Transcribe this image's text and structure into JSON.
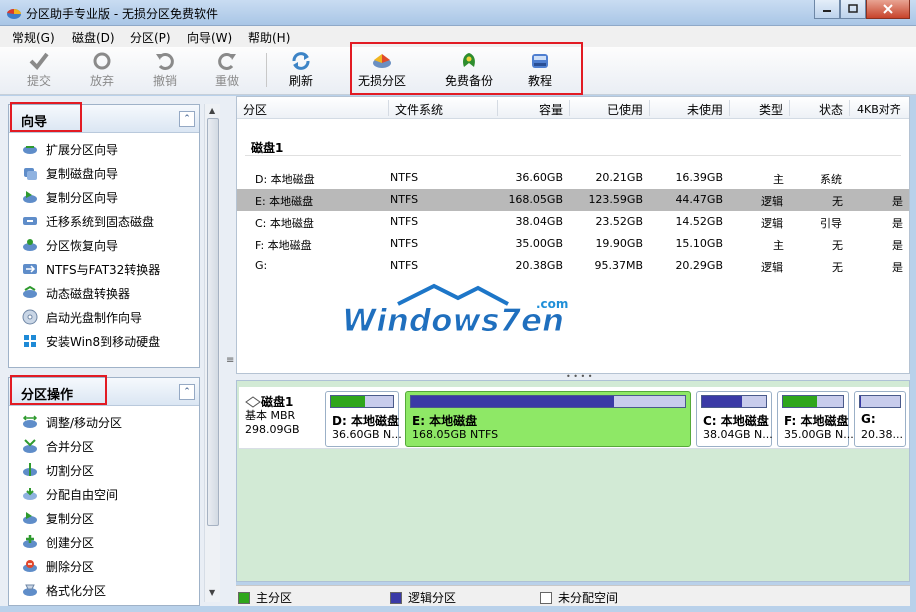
{
  "window": {
    "title": "分区助手专业版 - 无损分区免费软件"
  },
  "menu": [
    "常规(G)",
    "磁盘(D)",
    "分区(P)",
    "向导(W)",
    "帮助(H)"
  ],
  "toolbar": {
    "commit": "提交",
    "discard": "放弃",
    "undo": "撤销",
    "redo": "重做",
    "refresh": "刷新",
    "lossless": "无损分区",
    "backup": "免费备份",
    "tutorial": "教程"
  },
  "wizards": {
    "title": "向导",
    "items": [
      "扩展分区向导",
      "复制磁盘向导",
      "复制分区向导",
      "迁移系统到固态磁盘",
      "分区恢复向导",
      "NTFS与FAT32转换器",
      "动态磁盘转换器",
      "启动光盘制作向导",
      "安装Win8到移动硬盘"
    ]
  },
  "partition_ops": {
    "title": "分区操作",
    "items": [
      "调整/移动分区",
      "合并分区",
      "切割分区",
      "分配自由空间",
      "复制分区",
      "创建分区",
      "删除分区",
      "格式化分区"
    ]
  },
  "table": {
    "headers": [
      "分区",
      "文件系统",
      "容量",
      "已使用",
      "未使用",
      "类型",
      "状态",
      "4KB对齐"
    ],
    "disk_label": "磁盘1",
    "rows": [
      {
        "part": "D: 本地磁盘",
        "fs": "NTFS",
        "cap": "36.60GB",
        "used": "20.21GB",
        "free": "16.39GB",
        "type": "主",
        "status": "系统",
        "align": ""
      },
      {
        "part": "E: 本地磁盘",
        "fs": "NTFS",
        "cap": "168.05GB",
        "used": "123.59GB",
        "free": "44.47GB",
        "type": "逻辑",
        "status": "无",
        "align": "是"
      },
      {
        "part": "C: 本地磁盘",
        "fs": "NTFS",
        "cap": "38.04GB",
        "used": "23.52GB",
        "free": "14.52GB",
        "type": "逻辑",
        "status": "引导",
        "align": "是"
      },
      {
        "part": "F: 本地磁盘",
        "fs": "NTFS",
        "cap": "35.00GB",
        "used": "19.90GB",
        "free": "15.10GB",
        "type": "主",
        "status": "无",
        "align": "是"
      },
      {
        "part": "G:",
        "fs": "NTFS",
        "cap": "20.38GB",
        "used": "95.37MB",
        "free": "20.29GB",
        "type": "逻辑",
        "status": "无",
        "align": "是"
      }
    ]
  },
  "watermark": {
    "main": "Windows7en",
    "com": ".com"
  },
  "diskmap": {
    "disk": {
      "name": "磁盘1",
      "type": "基本 MBR",
      "size": "298.09GB"
    },
    "partitions": [
      {
        "name": "D: 本地磁盘",
        "detail": "36.60GB N...",
        "used": 0.55,
        "kind": "primary"
      },
      {
        "name": "E: 本地磁盘",
        "detail": "168.05GB NTFS",
        "used": 0.74,
        "kind": "logical"
      },
      {
        "name": "C: 本地磁盘",
        "detail": "38.04GB N...",
        "used": 0.62,
        "kind": "logical"
      },
      {
        "name": "F: 本地磁盘",
        "detail": "35.00GB N...",
        "used": 0.57,
        "kind": "primary"
      },
      {
        "name": "G:",
        "detail": "20.38...",
        "used": 0.01,
        "kind": "logical"
      }
    ]
  },
  "legend": {
    "primary": "主分区",
    "logical": "逻辑分区",
    "unallocated": "未分配空间"
  },
  "colors": {
    "primary_fill": "#2fa61b",
    "logical_fill": "#3a3aa6",
    "selected_bg": "#8ee866",
    "highlight_box": "#e21b23"
  }
}
